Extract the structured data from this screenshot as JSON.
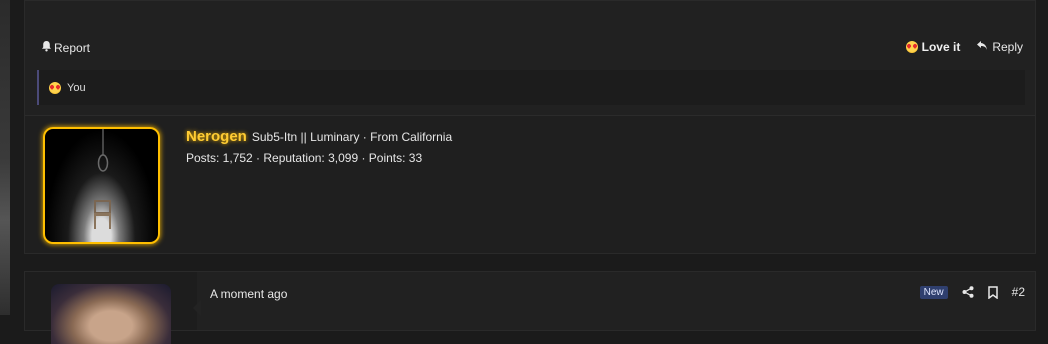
{
  "post1": {
    "actions": {
      "report_label": "Report",
      "love_label": "Love it",
      "reply_label": "Reply"
    },
    "reactions": {
      "reacted_by": "You"
    },
    "author": {
      "username": "Nerogen",
      "title": "Sub5-Itn || Luminary · From California",
      "stats": "Posts: 1,752 · Reputation: 3,099 · Points: 33"
    }
  },
  "post2": {
    "timestamp": "A moment ago",
    "badge": "New",
    "post_number": "#2"
  },
  "icons": [
    "bell-icon",
    "love-emoji-icon",
    "reply-icon",
    "share-icon",
    "bookmark-icon"
  ],
  "colors": {
    "username": "#ffcc33",
    "avatar_border": "#ffbf00",
    "new_badge": "#2f3f6e",
    "reactions_border": "#4b4a78"
  }
}
